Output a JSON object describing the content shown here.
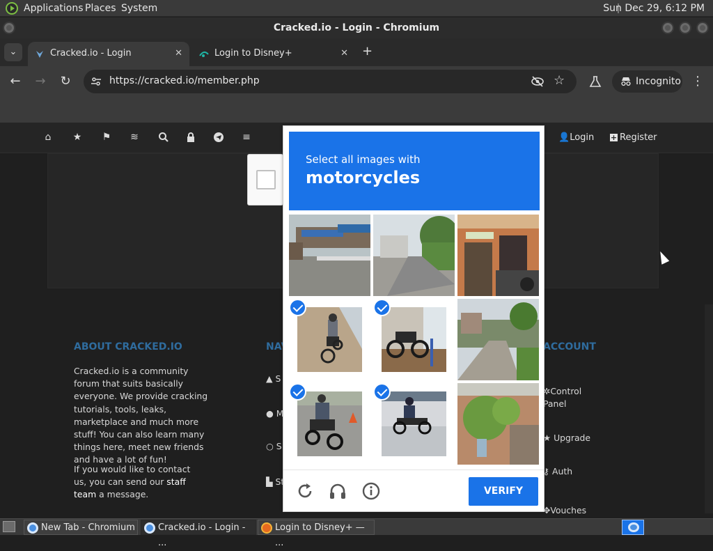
{
  "desktop": {
    "menu": [
      "Applications",
      "Places",
      "System"
    ],
    "clock": "Sun Dec 29,  6:12 PM"
  },
  "window": {
    "title": "Cracked.io - Login - Chromium"
  },
  "tabs": [
    {
      "label": "Cracked.io - Login",
      "close": "✕"
    },
    {
      "label": "Login to Disney+",
      "close": "✕"
    }
  ],
  "toolbar": {
    "url": "https://cracked.io/member.php",
    "incognito_label": "Incognito"
  },
  "site_nav": {
    "icons": [
      "home-icon",
      "star-icon",
      "flag-icon",
      "coins-icon",
      "search-icon",
      "lock-icon",
      "telegram-icon",
      "menu-icon"
    ],
    "login": "Login",
    "register": "Register"
  },
  "footer": {
    "about_heading": "ABOUT CRACKED.IO",
    "about_p1": "Cracked.io is a community forum that suits basically everyone. We provide cracking tutorials, tools, leaks, marketplace and much more stuff! You can also learn many things here, meet new friends and have a lot of fun!",
    "about_p2_pre": "If you would like to contact us, you can send our ",
    "about_p2_link": "staff team",
    "about_p2_post": " a message.",
    "nav_heading": "NAV",
    "nav_items": [
      "S",
      "M",
      "S",
      "St"
    ],
    "account_heading": "ACCOUNT",
    "account_items": [
      "Control Panel",
      "Upgrade",
      "Auth",
      "Vouches"
    ]
  },
  "captcha": {
    "prompt_line1": "Select all images with",
    "prompt_target": "motorcycles",
    "tiles": [
      {
        "name": "street-stalls",
        "selected": false
      },
      {
        "name": "street-corner",
        "selected": false
      },
      {
        "name": "storefront",
        "selected": false
      },
      {
        "name": "motorcycle-rider-dirt",
        "selected": true
      },
      {
        "name": "parked-motorcycle",
        "selected": true
      },
      {
        "name": "village-road",
        "selected": false
      },
      {
        "name": "motorcycle-rider-road",
        "selected": true
      },
      {
        "name": "scooter-rider",
        "selected": true
      },
      {
        "name": "garden-plants",
        "selected": false
      }
    ],
    "verify_label": "VERIFY"
  },
  "taskbar": {
    "tasks": [
      "New Tab - Chromium",
      "Cracked.io - Login - ...",
      "Login to Disney+ — ..."
    ]
  },
  "colors": {
    "captcha_blue": "#1a73e8",
    "footer_heading": "#2f6c9e"
  }
}
